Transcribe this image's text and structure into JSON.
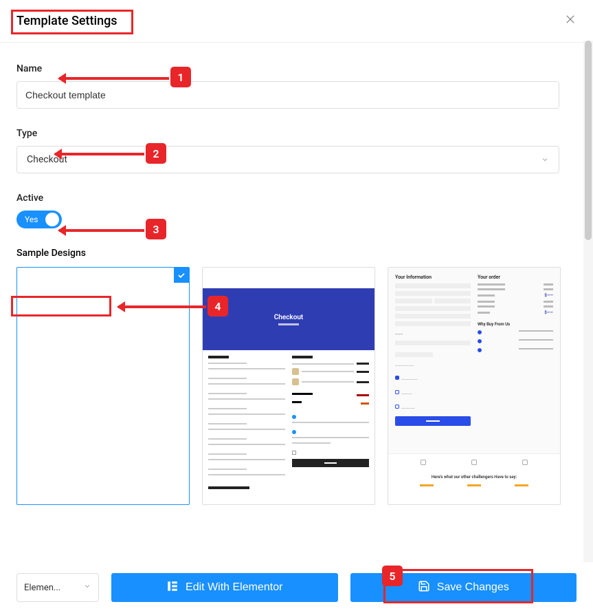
{
  "header": {
    "title": "Template Settings"
  },
  "fields": {
    "name_label": "Name",
    "name_value": "Checkout template",
    "type_label": "Type",
    "type_value": "Checkout",
    "active_label": "Active",
    "toggle_text": "Yes",
    "sample_designs_heading": "Sample Designs"
  },
  "designs": {
    "card2_title": "Checkout",
    "card3_left_heading": "Your Information",
    "card3_right_heading": "Your order",
    "card3_testimonial_heading": "Here's what our other challengers Have to say:"
  },
  "footer": {
    "builder_selected": "Elemen...",
    "edit_label": "Edit With Elementor",
    "save_label": "Save Changes"
  },
  "annotations": {
    "b1": "1",
    "b2": "2",
    "b3": "3",
    "b4": "4",
    "b5": "5"
  }
}
